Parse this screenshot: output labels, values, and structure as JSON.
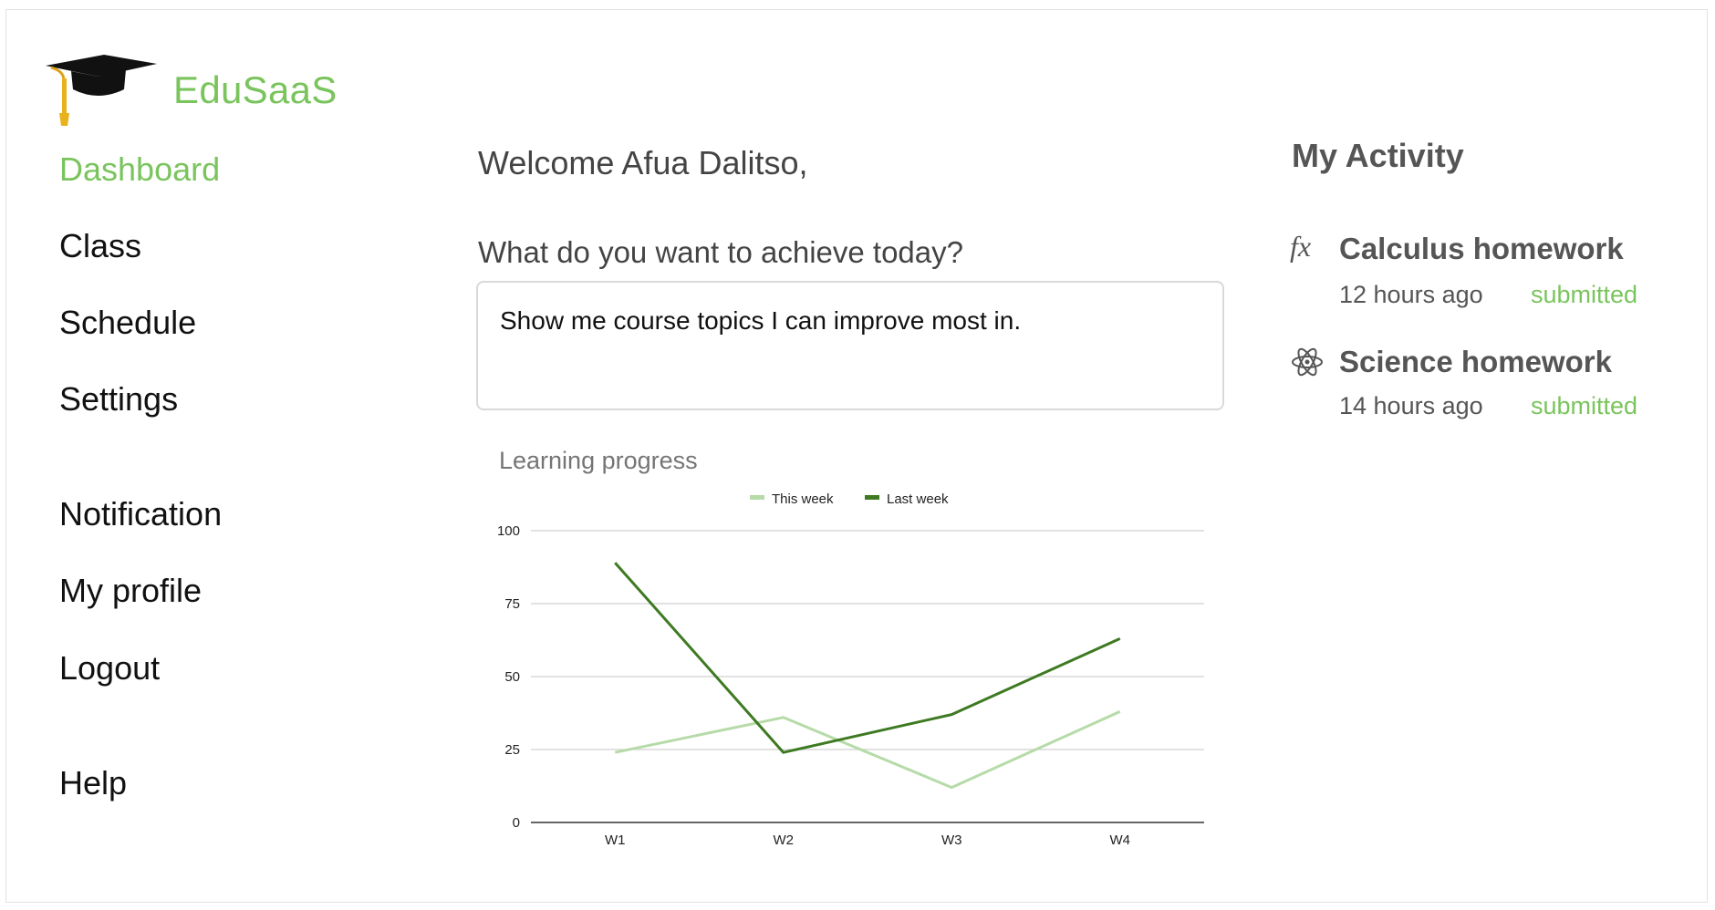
{
  "brand": {
    "name": "EduSaaS",
    "icon": "graduation-cap-icon",
    "color": "#7ac45d"
  },
  "nav": {
    "items": [
      {
        "label": "Dashboard",
        "active": true
      },
      {
        "label": "Class"
      },
      {
        "label": "Schedule"
      },
      {
        "label": "Settings"
      },
      {
        "label": "Notification"
      },
      {
        "label": "My profile"
      },
      {
        "label": "Logout"
      },
      {
        "label": "Help"
      }
    ]
  },
  "main": {
    "welcome": "Welcome Afua Dalitso,",
    "question": "What do you want to achieve today?",
    "prompt_value": "Show me course topics I can improve most in."
  },
  "chart_data": {
    "type": "line",
    "title": "Learning progress",
    "categories": [
      "W1",
      "W2",
      "W3",
      "W4"
    ],
    "series": [
      {
        "name": "This week",
        "values": [
          24,
          36,
          12,
          38
        ],
        "color": "#b6dba8"
      },
      {
        "name": "Last week",
        "values": [
          89,
          24,
          37,
          63
        ],
        "color": "#3d7a22"
      }
    ],
    "ylim": [
      0,
      100
    ],
    "yticks": [
      0,
      25,
      50,
      75,
      100
    ],
    "grid": true,
    "legend": "top-center"
  },
  "activity": {
    "title": "My Activity",
    "items": [
      {
        "icon": "function-fx-icon",
        "icon_text": "fx",
        "name": "Calculus homework",
        "time": "12 hours ago",
        "status": "submitted"
      },
      {
        "icon": "atom-icon",
        "name": "Science homework",
        "time": "14 hours ago",
        "status": "submitted"
      }
    ]
  }
}
